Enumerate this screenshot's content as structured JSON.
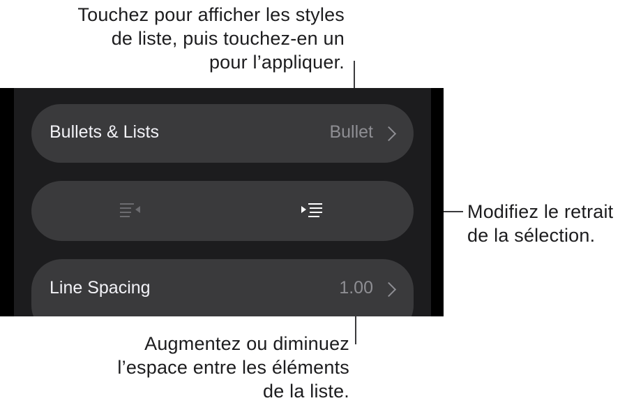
{
  "callouts": {
    "top": [
      "Touchez pour afficher les styles",
      "de liste, puis touchez-en un",
      "pour l’appliquer."
    ],
    "right": [
      "Modifiez le retrait",
      "de la sélection."
    ],
    "bottom": [
      "Augmentez ou diminuez",
      "l’espace entre les éléments",
      "de la liste."
    ]
  },
  "rows": {
    "bullets": {
      "label": "Bullets & Lists",
      "value": "Bullet"
    },
    "indent": {
      "outdent_icon": "decrease-indent-icon",
      "indent_icon": "increase-indent-icon"
    },
    "spacing": {
      "label": "Line Spacing",
      "value": "1.00"
    }
  },
  "colors": {
    "panel": "#1c1c1e",
    "row": "#3a3a3c",
    "secondary_text": "#8e8e93",
    "disabled_icon": "#6c6c70",
    "enabled_icon": "#ffffff"
  }
}
